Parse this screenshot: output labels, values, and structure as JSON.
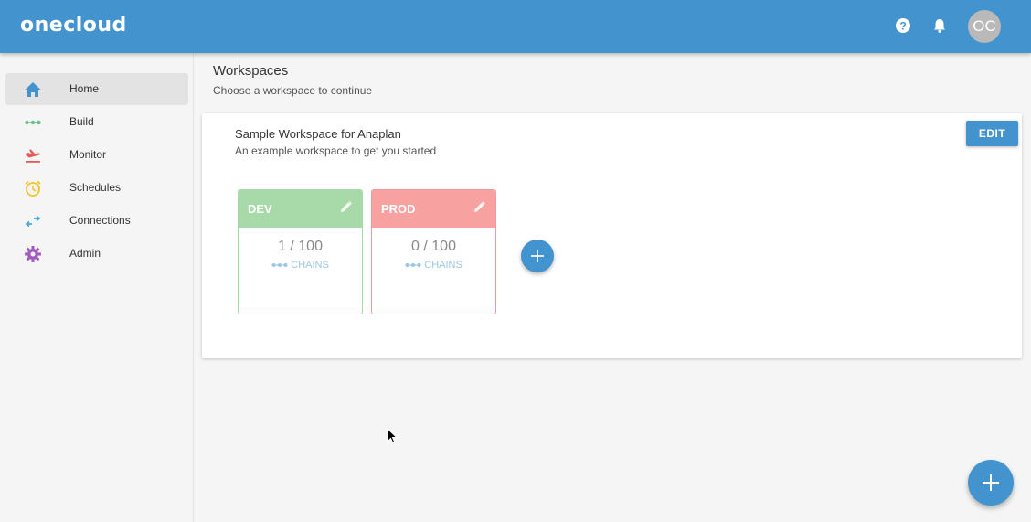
{
  "header": {
    "logo": "onecloud",
    "avatar_initials": "OC",
    "icons": [
      "help-icon",
      "bell-icon"
    ]
  },
  "sidebar": {
    "items": [
      {
        "label": "Home",
        "icon": "home-icon",
        "color": "#4393cf",
        "active": true
      },
      {
        "label": "Build",
        "icon": "chain-icon",
        "color": "#6cc08b"
      },
      {
        "label": "Monitor",
        "icon": "plane-icon",
        "color": "#e8585a"
      },
      {
        "label": "Schedules",
        "icon": "alarm-clock-icon",
        "color": "#f5c22a"
      },
      {
        "label": "Connections",
        "icon": "arrows-exchange-icon",
        "color": "#4aa8dd"
      },
      {
        "label": "Admin",
        "icon": "gear-icon",
        "color": "#a35bbf"
      }
    ]
  },
  "main": {
    "title": "Workspaces",
    "subtitle": "Choose a workspace to continue"
  },
  "workspace": {
    "title": "Sample Workspace for Anaplan",
    "description": "An example workspace to get you started",
    "edit_label": "EDIT",
    "environments": [
      {
        "name": "DEV",
        "count": "1 / 100",
        "chains_label": "CHAINS",
        "color": "#a8d9a8",
        "border": "#a8d9a8"
      },
      {
        "name": "PROD",
        "count": "0 / 100",
        "chains_label": "CHAINS",
        "color": "#f7a1a1",
        "border": "#f09b9b"
      }
    ]
  },
  "colors": {
    "accent": "#4393cf"
  }
}
